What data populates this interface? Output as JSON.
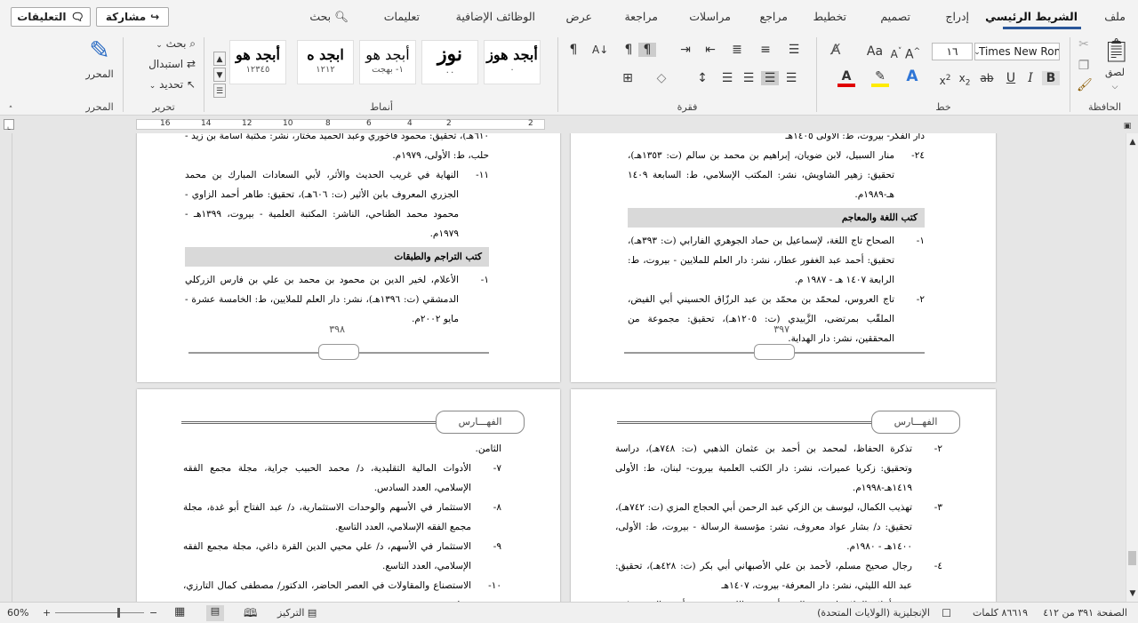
{
  "tabs": {
    "file": "ملف",
    "home": "الشريط الرئيسي",
    "insert": "إدراج",
    "design": "تصميم",
    "layout": "تخطيط",
    "references": "مراجع",
    "mailings": "مراسلات",
    "review": "مراجعة",
    "view": "عرض",
    "addins": "الوظائف الإضافية",
    "help": "تعليمات",
    "search": "بحث"
  },
  "share_label": "مشاركة",
  "comments_label": "التعليقات",
  "ribbon": {
    "clipboard": {
      "label": "الحافظة",
      "paste": "لصق"
    },
    "font": {
      "label": "خط",
      "font_name": "Times New Roman",
      "font_size": "١٦",
      "aa_label": "Aa"
    },
    "paragraph": {
      "label": "فقرة"
    },
    "styles": {
      "label": "أنماط",
      "items": [
        {
          "big": "أبجد هوز",
          "sub": "٠"
        },
        {
          "big": "نوز",
          "sub": "٠٠"
        },
        {
          "big": "أبجد هو",
          "sub": "١- بهجت"
        },
        {
          "big": "ابجد ه",
          "sub": "١٢١٢"
        },
        {
          "big": "أبجد هو",
          "sub": "١٢٣٤٥"
        }
      ]
    },
    "editing": {
      "label": "تحرير",
      "find": "بحث",
      "replace": "استبدال",
      "select": "تحديد"
    },
    "editor": {
      "label": "المحرر",
      "button": "المحرر"
    }
  },
  "ruler_marks": [
    "2",
    "2",
    "4",
    "6",
    "8",
    "10",
    "12",
    "14",
    "16"
  ],
  "pages": [
    {
      "id": "p397",
      "number": "٣٩٧",
      "items": [
        {
          "type": "cont",
          "text": "دار الفكر- بيروت، ط: الأولى ١٤٠٥هـ"
        },
        {
          "type": "entry",
          "num": "٢٤-",
          "text": "منار السبيل، لابن ضويان، إبراهيم بن محمد بن سالم (ت: ١٣٥٣هـ)، تحقيق: زهير الشاويش، نشر: المكتب الإسلامي، ط: السابعة ١٤٠٩ هـ-١٩٨٩م."
        },
        {
          "type": "head",
          "text": "كتب اللغة والمعاجم"
        },
        {
          "type": "entry",
          "num": "١-",
          "text": "الصحاح تاج اللغة، لإسماعيل بن حماد الجوهري الفارابي (ت: ٣٩٣هـ)، تحقيق: أحمد عبد الغفور عطار، نشر: دار العلم للملايين - بيروت، ط: الرابعة ١٤٠٧ هـ - ١٩٨٧ م."
        },
        {
          "type": "entry",
          "num": "٢-",
          "text": "تاج العروس، لمحمّد بن محمّد بن عبد الرزّاق الحسيني أبي الفيض، الملقّب بمرتضى، الزَّبيدي (ت: ١٢٠٥هـ)، تحقيق: مجموعة من المحققين، نشر: دار الهداية."
        }
      ]
    },
    {
      "id": "p398",
      "number": "٣٩٨",
      "items": [
        {
          "type": "cont",
          "text": "٦١٠هـ)، تحقيق: محمود فاخوري وعبد الحميد مختار، نشر: مكتبة أسامة بن زيد - حلب، ط: الأولى، ١٩٧٩م."
        },
        {
          "type": "entry",
          "num": "١١-",
          "text": "النهاية في غريب الحديث والأثر، لأبي السعادات المبارك بن محمد الجزري المعروف بابن الأثير (ت: ٦٠٦هـ)، تحقيق: طاهر أحمد الزاوي - محمود محمد الطناحي، الناشر: المكتبة العلمية - بيروت، ١٣٩٩هـ - ١٩٧٩م."
        },
        {
          "type": "head",
          "text": "كتب التراجم والطبقات"
        },
        {
          "type": "entry",
          "num": "١-",
          "text": "الأعلام، لخير الدين بن محمود بن محمد بن علي بن فارس الزركلي الدمشقي (ت: ١٣٩٦هـ)، نشر: دار العلم للملايين، ط: الخامسة عشرة - مايو ٢٠٠٢م."
        }
      ]
    },
    {
      "id": "p399",
      "header": "الفهـــارس",
      "items": [
        {
          "type": "entry",
          "num": "٢-",
          "text": "تذكرة الحفاظ، لمحمد بن أحمد بن عثمان الذهبي (ت: ٧٤٨هـ)، دراسة وتحقيق: زكريا عميرات، نشر: دار الكتب العلمية بيروت- لبنان، ط: الأولى ١٤١٩هـ-١٩٩٨م."
        },
        {
          "type": "entry",
          "num": "٣-",
          "text": "تهذيب الكمال، ليوسف بن الزكي عبد الرحمن أبي الحجاج المزي (ت: ٧٤٢هـ)، تحقيق: د/ بشار عواد معروف، نشر: مؤسسة الرسالة - بيروت، ط: الأولى، ١٤٠٠هـ - ١٩٨٠م."
        },
        {
          "type": "entry",
          "num": "٤-",
          "text": "رجال صحيح مسلم، لأحمد بن علي الأصبهاني أبي بكر (ت: ٤٢٨هـ)، تحقيق: عبد الله الليثي، نشر: دار المعرفة- بيروت، ١٤٠٧هـ"
        },
        {
          "type": "entry",
          "num": "٥-",
          "text": "سير أعلام النبلاء، لشمس الدين أبي عبد الله محمد بن أحمد الذهبي (ت: ٧٤٨هـ)، تحقيق: مجموعة محققين بإشراف شعيب الأرناؤوط، نشر: مؤسسة الرسالة، تقديم بشار عواد"
        }
      ]
    },
    {
      "id": "p400",
      "header": "الفهـــارس",
      "items": [
        {
          "type": "cont",
          "text": "الثامن."
        },
        {
          "type": "entry",
          "num": "٧-",
          "text": "الأدوات المالية التقليدية، د/ محمد الحبيب جراية، مجلة مجمع الفقه الإسلامي، العدد السادس."
        },
        {
          "type": "entry",
          "num": "٨-",
          "text": "الاستثمار في الأسهم والوحدات الاستثمارية، د/ عبد الفتاح أبو غدة، مجلة مجمع الفقه الإسلامي، العدد التاسع."
        },
        {
          "type": "entry",
          "num": "٩-",
          "text": "الاستثمار في الأسهم، د/ علي محيي الدين القرة داغي، مجلة مجمع الفقه الإسلامي، العدد التاسع."
        },
        {
          "type": "entry",
          "num": "١٠-",
          "text": "الاستصناع والمقاولات في العصر الحاضر، الدكتور/ مصطفى كمال التارزي، مجلة مجمع"
        }
      ]
    }
  ],
  "status": {
    "page": "الصفحة ٣٩١ من ٤١٢",
    "words": "٨٦٦١٩ كلمات",
    "language": "الإنجليزية (الولايات المتحدة)",
    "focus": "التركيز",
    "zoom": "60%"
  }
}
